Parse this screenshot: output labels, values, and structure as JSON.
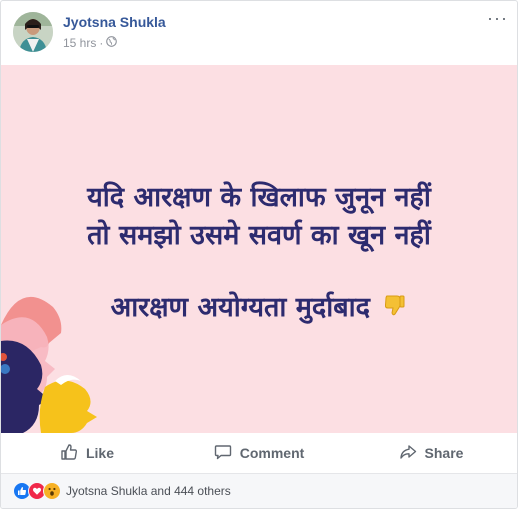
{
  "post": {
    "author": "Jyotsna Shukla",
    "time": "15 hrs",
    "separator": "·",
    "more_glyph": "···",
    "image_text": {
      "line1": "यदि आरक्षण के खिलाफ जुनून नहीं",
      "line2": "तो समझो उसमे सवर्ण का खून नहीं",
      "line3": "आरक्षण अयोग्यता मुर्दाबाद",
      "text_color": "#2d2b6f",
      "background": "#fcdfe3"
    }
  },
  "actions": {
    "like": "Like",
    "comment": "Comment",
    "share": "Share"
  },
  "reactions": {
    "icons": [
      "like-reaction-icon",
      "love-reaction-icon",
      "wow-reaction-icon"
    ],
    "summary": "Jyotsna Shukla and 444 others"
  },
  "colors": {
    "author_link": "#365899",
    "meta": "#90949c",
    "action_text": "#606770",
    "like_blue": "#1877f2",
    "love_red": "#f0284a",
    "wow_yellow": "#f7b125"
  }
}
